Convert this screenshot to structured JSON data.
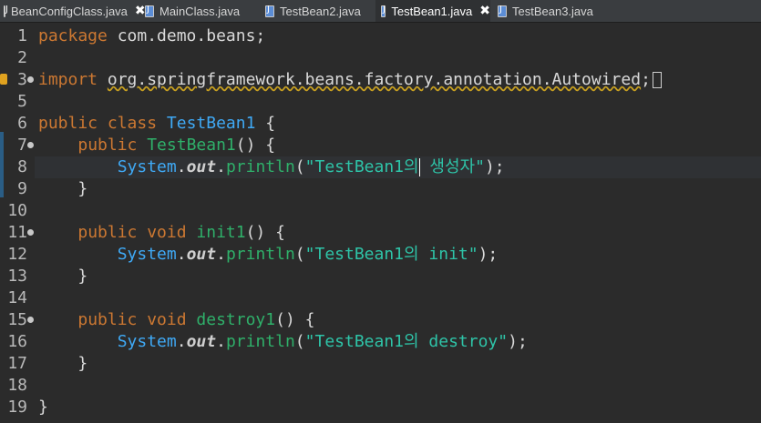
{
  "tabs": [
    {
      "label": "BeanConfigClass.java",
      "closable": true
    },
    {
      "label": "MainClass.java",
      "closable": false
    },
    {
      "label": "TestBean2.java",
      "closable": false
    },
    {
      "label": "TestBean1.java",
      "closable": true,
      "active": true
    },
    {
      "label": "TestBean3.java",
      "closable": false
    }
  ],
  "close_glyph": "✖",
  "lines": [
    {
      "n": "1"
    },
    {
      "n": "2"
    },
    {
      "n": "3"
    },
    {
      "n": "5"
    },
    {
      "n": "6"
    },
    {
      "n": "7"
    },
    {
      "n": "8"
    },
    {
      "n": "9"
    },
    {
      "n": "10"
    },
    {
      "n": "11"
    },
    {
      "n": "12"
    },
    {
      "n": "13"
    },
    {
      "n": "14"
    },
    {
      "n": "15"
    },
    {
      "n": "16"
    },
    {
      "n": "17"
    },
    {
      "n": "18"
    },
    {
      "n": "19"
    }
  ],
  "code": {
    "l1_kw": "package",
    "l1_rest": " com.demo.beans;",
    "l3_kw": "import",
    "l3_space": " ",
    "l3_pkg": "org.springframework.beans.factory.annotation.Autowired",
    "l3_semi": ";",
    "l6_kw": "public class ",
    "l6_cls": "TestBean1",
    "l6_rest": " {",
    "l7_indent": "    ",
    "l7_kw": "public ",
    "l7_cls": "TestBean1",
    "l7_rest": "() {",
    "l8_indent": "        ",
    "l8_sys": "System",
    "l8_dot1": ".",
    "l8_out": "out",
    "l8_dot2": ".",
    "l8_meth": "println",
    "l8_open": "(",
    "l8_str1": "\"TestBean1의",
    "l8_str2": " 생성자\"",
    "l8_close": ");",
    "l9": "    }",
    "l11_indent": "    ",
    "l11_kw": "public void ",
    "l11_meth": "init1",
    "l11_rest": "() {",
    "l12_indent": "        ",
    "l12_sys": "System",
    "l12_dot1": ".",
    "l12_out": "out",
    "l12_dot2": ".",
    "l12_meth": "println",
    "l12_open": "(",
    "l12_str": "\"TestBean1의 init\"",
    "l12_close": ");",
    "l13": "    }",
    "l15_indent": "    ",
    "l15_kw": "public void ",
    "l15_meth": "destroy1",
    "l15_rest": "() {",
    "l16_indent": "        ",
    "l16_sys": "System",
    "l16_dot1": ".",
    "l16_out": "out",
    "l16_dot2": ".",
    "l16_meth": "println",
    "l16_open": "(",
    "l16_str": "\"TestBean1의 destroy\"",
    "l16_close": ");",
    "l17": "    }",
    "l19": "}"
  }
}
